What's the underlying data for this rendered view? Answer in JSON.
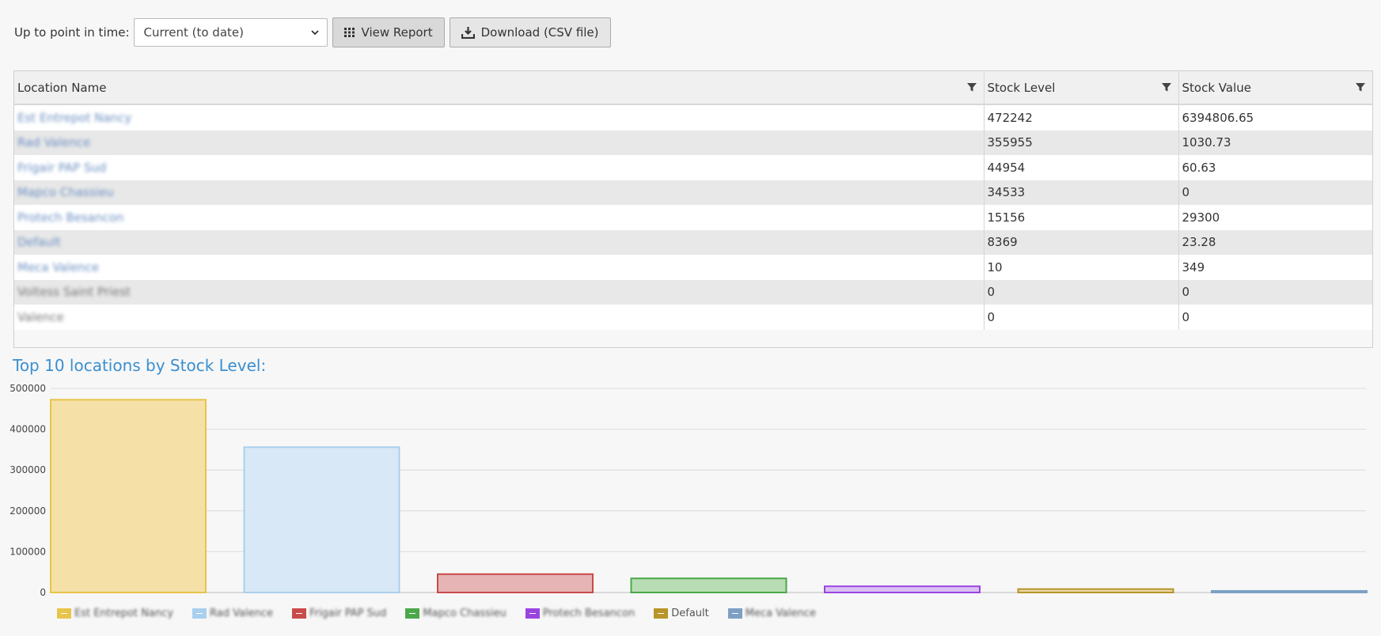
{
  "toolbar": {
    "label": "Up to point in time:",
    "select_value": "Current (to date)",
    "view_report": "View Report",
    "download": "Download (CSV file)"
  },
  "table": {
    "headers": [
      "Location Name",
      "Stock Level",
      "Stock Value"
    ],
    "rows": [
      {
        "name": "Est Entrepot Nancy",
        "level": "472242",
        "value": "6394806.65",
        "link": true
      },
      {
        "name": "Rad Valence",
        "level": "355955",
        "value": "1030.73",
        "link": true
      },
      {
        "name": "Frigair PAP Sud",
        "level": "44954",
        "value": "60.63",
        "link": true
      },
      {
        "name": "Mapco Chassieu",
        "level": "34533",
        "value": "0",
        "link": true
      },
      {
        "name": "Protech Besancon",
        "level": "15156",
        "value": "29300",
        "link": true
      },
      {
        "name": "Default",
        "level": "8369",
        "value": "23.28",
        "link": true
      },
      {
        "name": "Meca Valence",
        "level": "10",
        "value": "349",
        "link": true
      },
      {
        "name": "Voltess Saint Priest",
        "level": "0",
        "value": "0",
        "link": false
      },
      {
        "name": "Valence",
        "level": "0",
        "value": "0",
        "link": false
      }
    ]
  },
  "chart_title": "Top 10 locations by Stock Level:",
  "chart_data": {
    "type": "bar",
    "categories": [
      "Est Entrepot Nancy",
      "Rad Valence",
      "Frigair PAP Sud",
      "Mapco Chassieu",
      "Protech Besancon",
      "Default",
      "Meca Valence"
    ],
    "values": [
      472242,
      355955,
      44954,
      34533,
      15156,
      8369,
      10
    ],
    "ylim": [
      0,
      500000
    ],
    "yticks": [
      "0",
      "100000",
      "200000",
      "300000",
      "400000",
      "500000"
    ],
    "grid": true,
    "legend_position": "bottom",
    "colors": [
      {
        "fill": "#f5e0a8",
        "stroke": "#e8c44a"
      },
      {
        "fill": "#d8e8f6",
        "stroke": "#a9cfee"
      },
      {
        "fill": "#e6b4b4",
        "stroke": "#c94a4a"
      },
      {
        "fill": "#b8ddb4",
        "stroke": "#4aa84a"
      },
      {
        "fill": "#d9c0f2",
        "stroke": "#9a44e0"
      },
      {
        "fill": "#e8d8a8",
        "stroke": "#b8952a"
      },
      {
        "fill": "#c4d4e6",
        "stroke": "#7d9fc4"
      }
    ]
  }
}
